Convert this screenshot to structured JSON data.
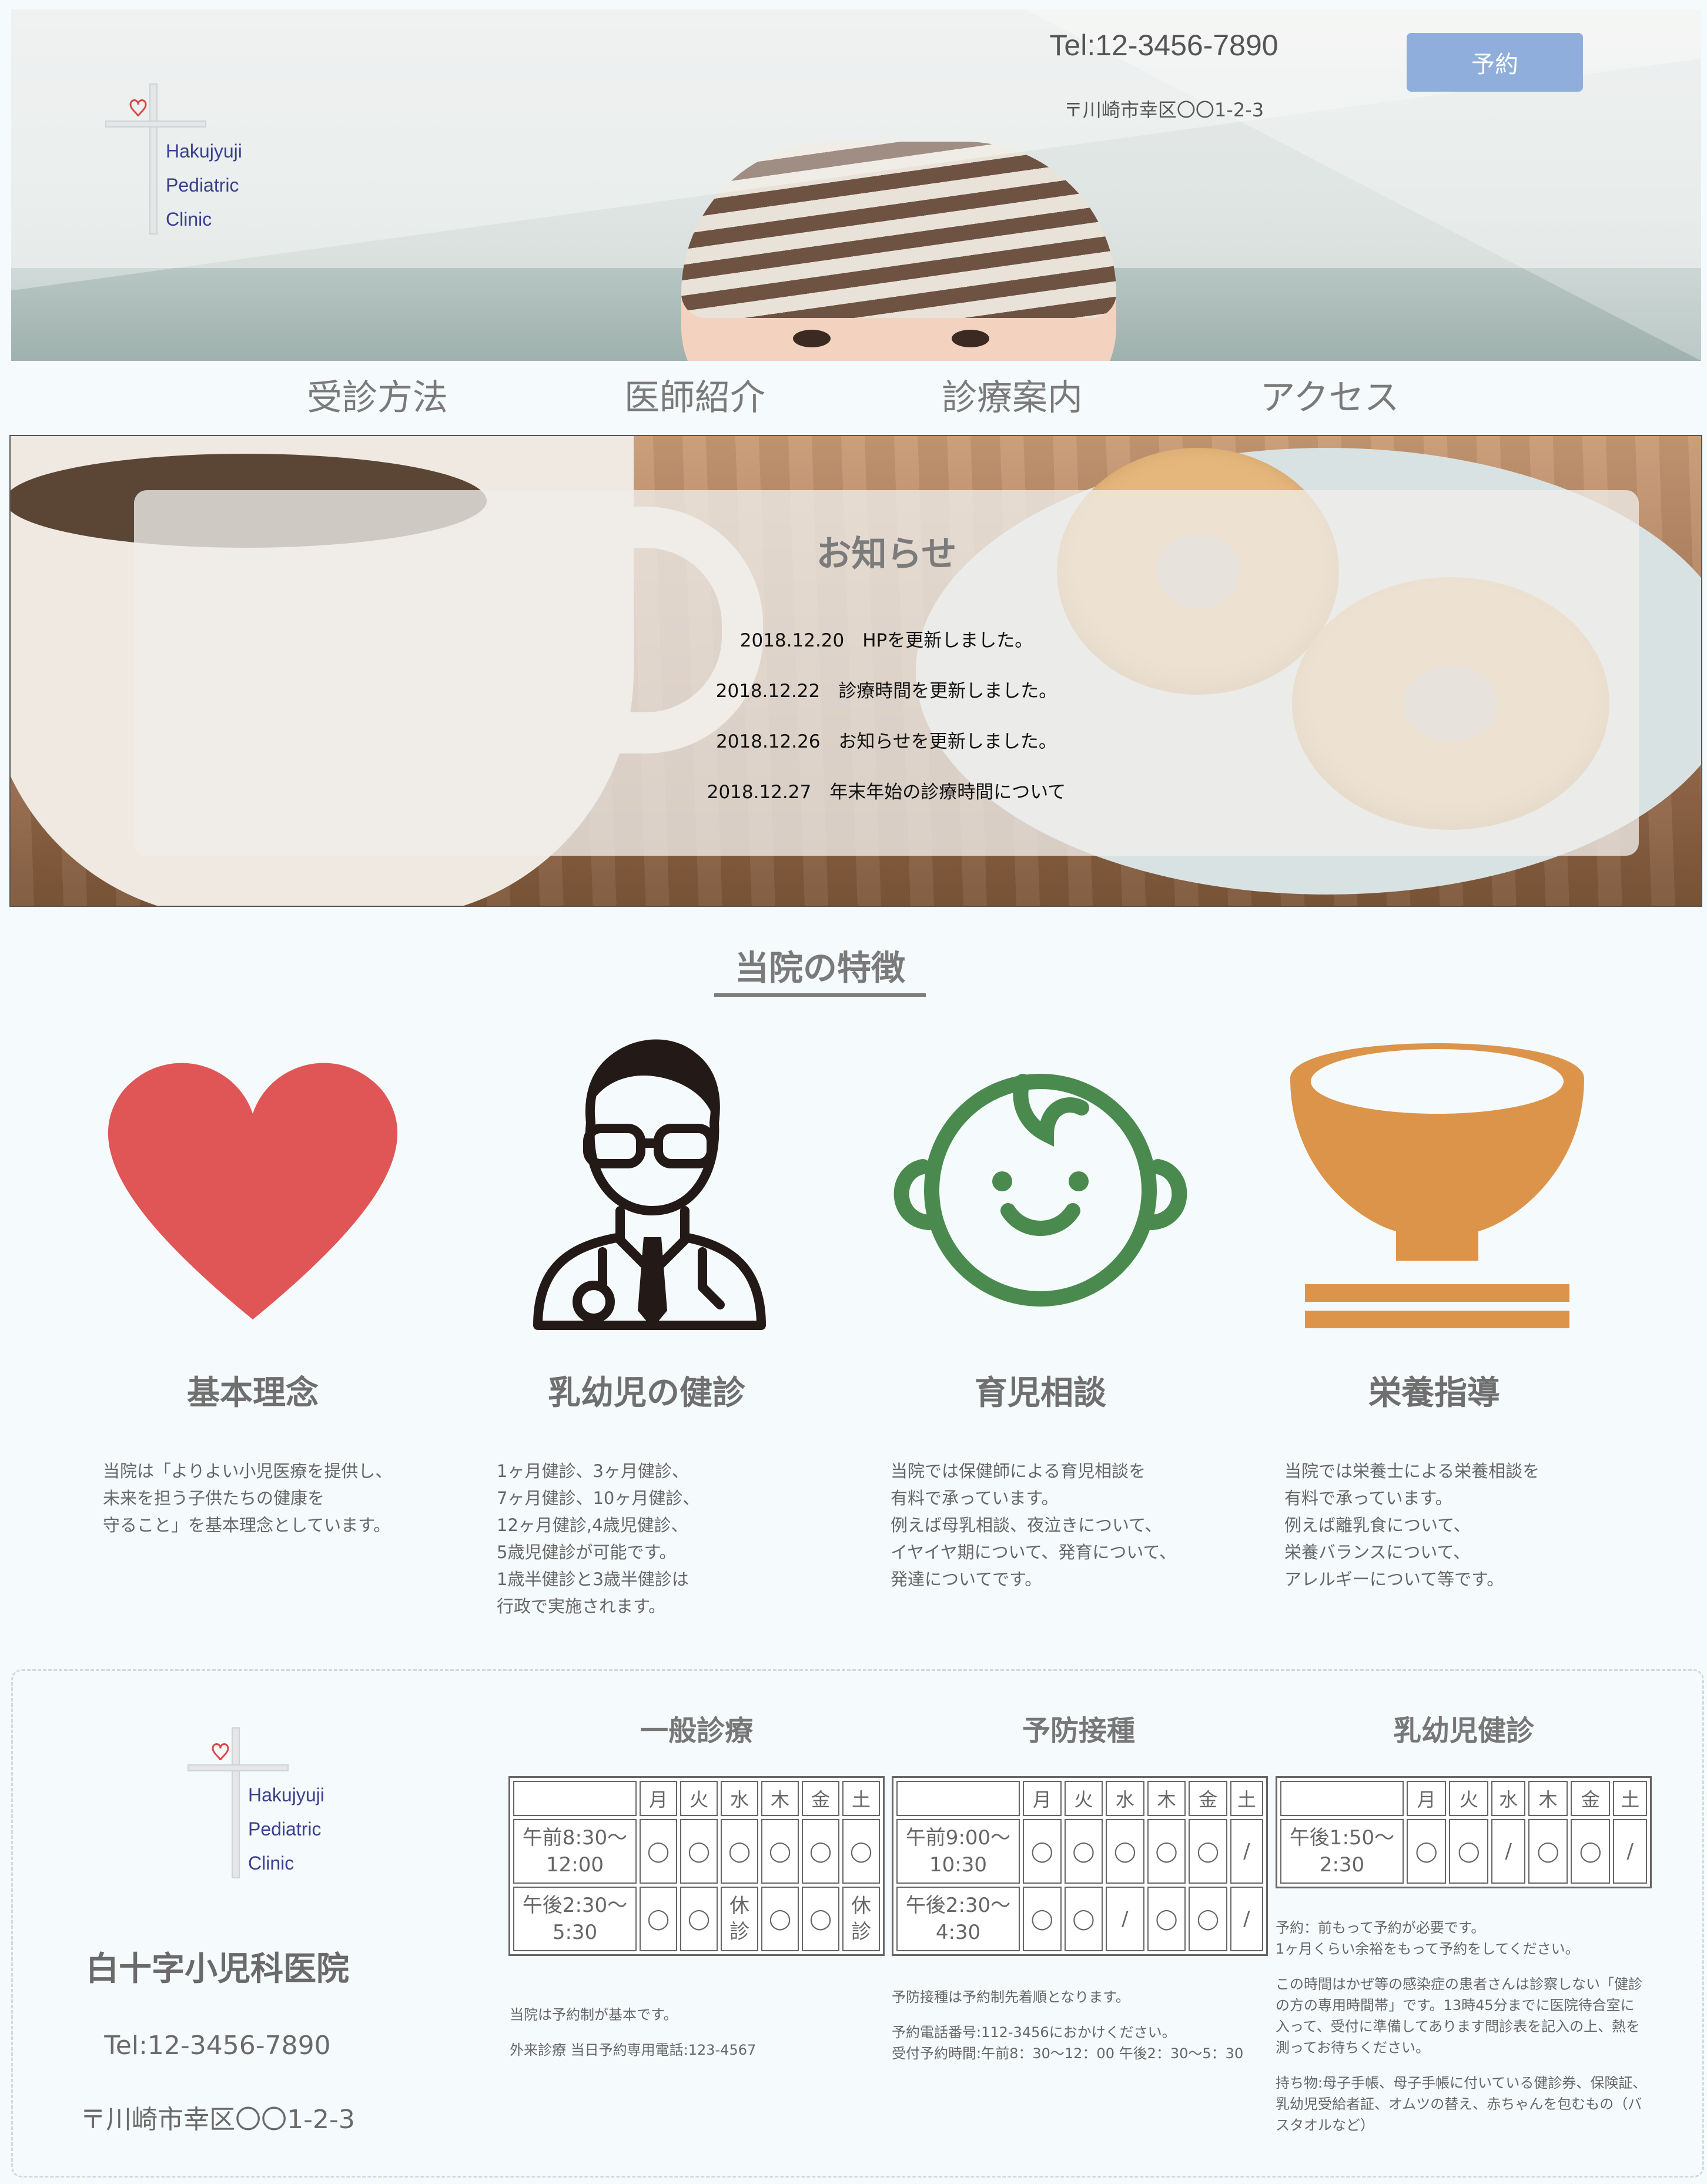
{
  "header": {
    "logo_lines": [
      "Hakujyuji",
      "Pediatric",
      "Clinic"
    ],
    "tel": "Tel:12-3456-7890",
    "address": "〒川崎市幸区〇〇1-2-3",
    "reserve_label": "予約"
  },
  "nav": {
    "items": [
      "受診方法",
      "医師紹介",
      "診療案内",
      "アクセス"
    ]
  },
  "news": {
    "title": "お知らせ",
    "items": [
      "2018.12.20　HPを更新しました。",
      "2018.12.22　診療時間を更新しました。",
      "2018.12.26　お知らせを更新しました。",
      "2018.12.27　年末年始の診療時間について"
    ]
  },
  "features": {
    "title": "当院の特徴",
    "items": [
      {
        "icon": "heart-icon",
        "title": "基本理念",
        "lines": [
          "当院は「よりよい小児医療を提供し、",
          "未来を担う子供たちの健康を",
          "守ること」を基本理念としています。"
        ]
      },
      {
        "icon": "doctor-icon",
        "title": "乳幼児の健診",
        "lines": [
          "1ヶ月健診、3ヶ月健診、",
          "7ヶ月健診、10ヶ月健診、",
          "12ヶ月健診,4歳児健診、",
          "5歳児健診が可能です。",
          "1歳半健診と3歳半健診は",
          "行政で実施されます。"
        ]
      },
      {
        "icon": "baby-face-icon",
        "title": "育児相談",
        "lines": [
          "当院では保健師による育児相談を",
          "有料で承っています。",
          "例えば母乳相談、夜泣きについて、",
          "イヤイヤ期について、発育について、",
          "発達についてです。"
        ]
      },
      {
        "icon": "rice-bowl-icon",
        "title": "栄養指導",
        "lines": [
          "当院では栄養士による栄養相談を",
          "有料で承っています。",
          "例えば離乳食について、",
          "栄養バランスについて、",
          "アレルギーについて等です。"
        ]
      }
    ]
  },
  "footer": {
    "logo_lines": [
      "Hakujyuji",
      "Pediatric",
      "Clinic"
    ],
    "clinic_name": "白十字小児科医院",
    "tel": "Tel:12-3456-7890",
    "address": "〒川崎市幸区〇〇1-2-3"
  },
  "days": [
    "月",
    "火",
    "水",
    "木",
    "金",
    "土"
  ],
  "schedules": [
    {
      "title": "一般診療",
      "rows": [
        {
          "time": [
            "午前8:30〜",
            "12:00"
          ],
          "cells": [
            "◯",
            "◯",
            "◯",
            "◯",
            "◯",
            "◯"
          ]
        },
        {
          "time": [
            "午後2:30〜",
            "5:30"
          ],
          "cells": [
            "◯",
            "◯",
            "休\n診",
            "◯",
            "◯",
            "休\n診"
          ]
        }
      ],
      "notes": [
        "当院は予約制が基本です。",
        "",
        "外来診療 当日予約専用電話:123-4567"
      ]
    },
    {
      "title": "予防接種",
      "rows": [
        {
          "time": [
            "午前9:00〜",
            "10:30"
          ],
          "cells": [
            "◯",
            "◯",
            "◯",
            "◯",
            "◯",
            "/"
          ]
        },
        {
          "time": [
            "午後2:30〜",
            "4:30"
          ],
          "cells": [
            "◯",
            "◯",
            "/",
            "◯",
            "◯",
            "/"
          ]
        }
      ],
      "notes": [
        "予防接種は予約制先着順となります。",
        "",
        "予約電話番号:112-3456におかけください。",
        "受付予約時間:午前8：30〜12：00 午後2：30〜5：30"
      ]
    },
    {
      "title": "乳幼児健診",
      "rows": [
        {
          "time": [
            "午後1:50〜",
            "2:30"
          ],
          "cells": [
            "◯",
            "◯",
            "/",
            "◯",
            "◯",
            "/"
          ]
        }
      ],
      "notes": [
        "予約：前もって予約が必要です。",
        "1ヶ月くらい余裕をもって予約をしてください。",
        "",
        "この時間はかぜ等の感染症の患者さんは診察しない「健診",
        "の方の専用時間帯」です。13時45分までに医院待合室に",
        "入って、受付に準備してあります問診表を記入の上、熱を",
        "測ってお待ちください。",
        "",
        "持ち物:母子手帳、母子手帳に付いている健診券、保険証、",
        "乳幼児受給者証、オムツの替え、赤ちゃんを包むもの（バ",
        "スタオルなど）"
      ]
    }
  ],
  "colors": {
    "reserve_button": "#8faedb",
    "logo_text": "#3a3f8f",
    "heart": "#e05555",
    "baby_face": "#4a8a4e",
    "bowl": "#dc944a",
    "doctor": "#231a18"
  }
}
